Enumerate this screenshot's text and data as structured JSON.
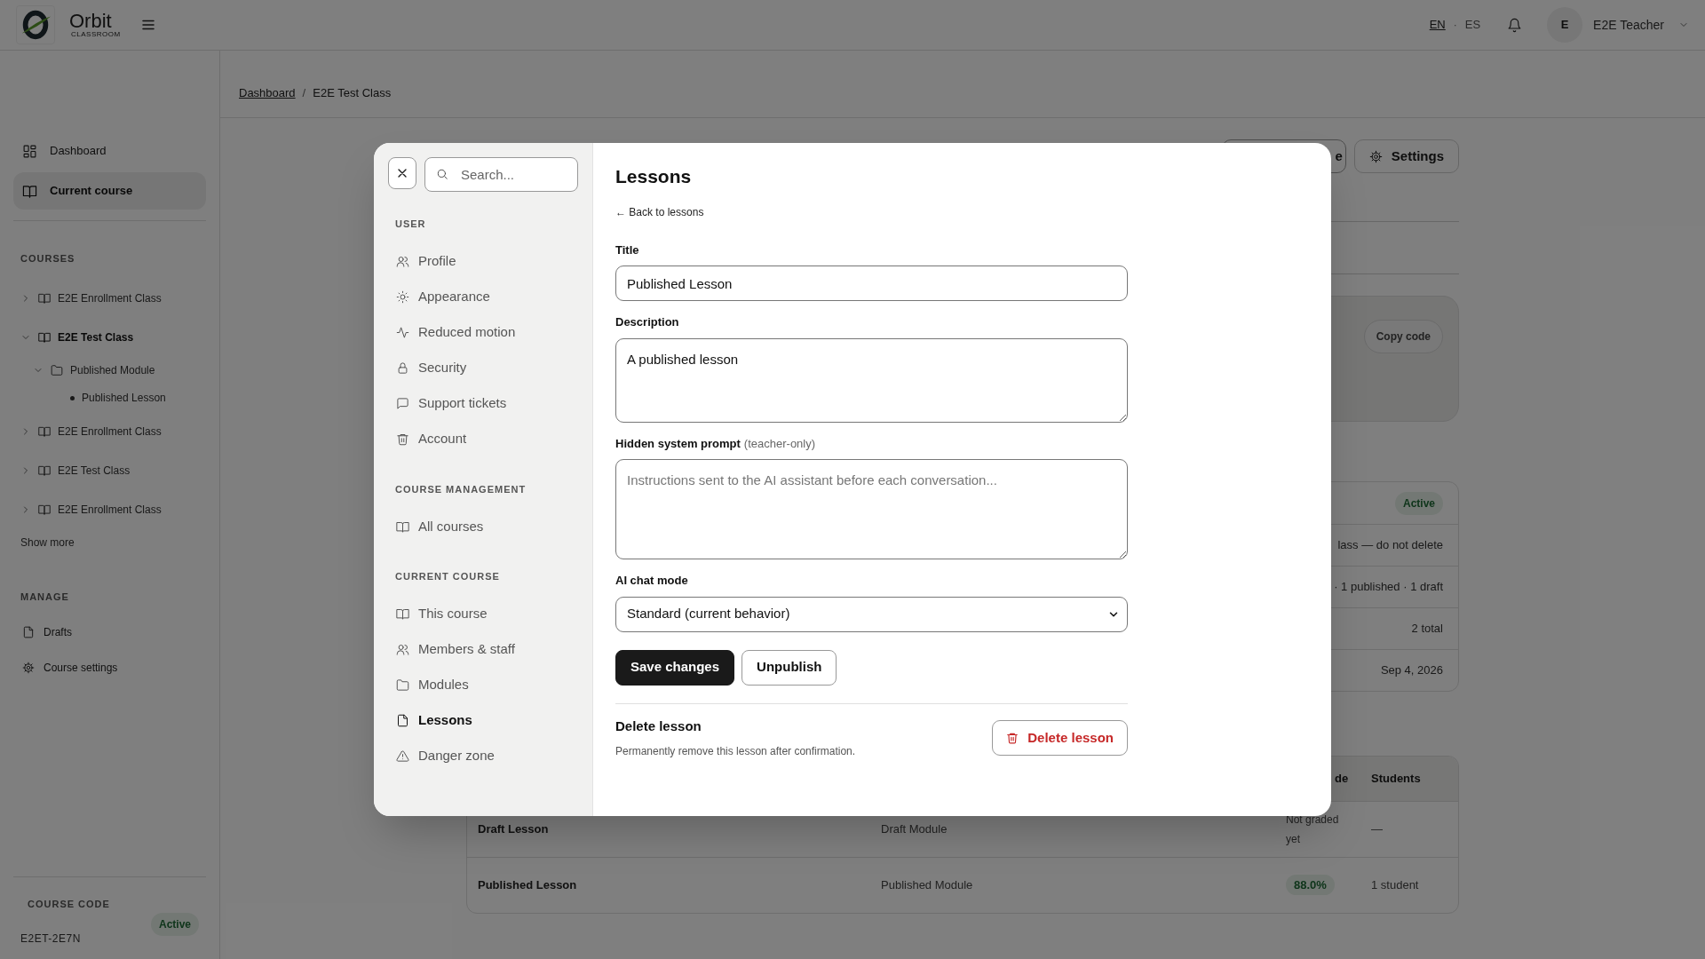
{
  "topbar": {
    "brand": "Orbit",
    "brand_sub": "CLASSROOM",
    "languages": [
      {
        "label": "EN",
        "selected": true
      },
      {
        "label": "ES",
        "selected": false
      }
    ],
    "language_separator": "·",
    "user": {
      "initial": "E",
      "name": "E2E Teacher"
    }
  },
  "sidebar": {
    "nav": [
      {
        "label": "Dashboard",
        "kind": "grid",
        "selected": false
      },
      {
        "label": "Current course",
        "kind": "book",
        "selected": true
      }
    ],
    "courses_heading": "COURSES",
    "courses": [
      {
        "kind": "course",
        "label": "E2E Enrollment Class",
        "selected": false,
        "expanded": false
      },
      {
        "kind": "course",
        "label": "E2E Test Class",
        "selected": true,
        "expanded": true,
        "children": [
          {
            "kind": "module",
            "label": "Published Module",
            "selected": false,
            "expanded": true,
            "children": [
              {
                "kind": "lesson",
                "label": "Published Lesson",
                "selected": false
              }
            ]
          }
        ]
      },
      {
        "kind": "course",
        "label": "E2E Enrollment Class",
        "selected": false,
        "expanded": false
      },
      {
        "kind": "course",
        "label": "E2E Test Class",
        "selected": false,
        "expanded": false
      },
      {
        "kind": "course",
        "label": "E2E Enrollment Class",
        "selected": false,
        "expanded": false
      }
    ],
    "show_more": "Show more",
    "manage_heading": "MANAGE",
    "manage": [
      {
        "label": "Drafts",
        "kind": "file"
      },
      {
        "label": "Course settings",
        "kind": "gear"
      }
    ],
    "course_code": {
      "heading": "COURSE CODE",
      "status": "Active",
      "code": "E2ET-2E7N"
    }
  },
  "breadcrumb": [
    {
      "label": "Dashboard",
      "kind": "link"
    },
    {
      "label": "/",
      "kind": "separator"
    },
    {
      "label": "E2E Test Class",
      "kind": "current"
    }
  ],
  "page": {
    "buttons": [
      {
        "label": "e",
        "kind": "plain"
      },
      {
        "label": "Settings",
        "kind": "gear"
      }
    ],
    "code_card": {
      "button": "Copy code"
    },
    "details": [
      {
        "kind": "badge",
        "text": "Active"
      },
      {
        "kind": "text",
        "text": "lass — do not delete"
      },
      {
        "kind": "text",
        "text": "· 1 published · 1 draft"
      },
      {
        "kind": "text",
        "text": "2 total"
      },
      {
        "kind": "text",
        "text": "Sep 4, 2026"
      }
    ],
    "table": {
      "columns": [
        "",
        "",
        "de",
        "Students"
      ],
      "rows": [
        {
          "cells": [
            "Draft Lesson",
            "Draft Module",
            "Not graded yet",
            "—"
          ],
          "kind": "ungraded"
        },
        {
          "cells": [
            "Published Lesson",
            "Published Module",
            "88.0%",
            "1 student"
          ],
          "kind": "graded"
        }
      ]
    }
  },
  "modal": {
    "search": {
      "placeholder": "Search..."
    },
    "sections": [
      {
        "heading": "USER",
        "items": [
          {
            "label": "Profile",
            "kind": "users",
            "selected": false
          },
          {
            "label": "Appearance",
            "kind": "sun",
            "selected": false
          },
          {
            "label": "Reduced motion",
            "kind": "activity",
            "selected": false
          },
          {
            "label": "Security",
            "kind": "lock",
            "selected": false
          },
          {
            "label": "Support tickets",
            "kind": "message",
            "selected": false
          },
          {
            "label": "Account",
            "kind": "trash",
            "selected": false
          }
        ]
      },
      {
        "heading": "COURSE MANAGEMENT",
        "items": [
          {
            "label": "All courses",
            "kind": "book",
            "selected": false
          }
        ]
      },
      {
        "heading": "CURRENT COURSE",
        "items": [
          {
            "label": "This course",
            "kind": "book",
            "selected": false
          },
          {
            "label": "Members & staff",
            "kind": "users",
            "selected": false
          },
          {
            "label": "Modules",
            "kind": "folder",
            "selected": false
          },
          {
            "label": "Lessons",
            "kind": "file",
            "selected": true
          },
          {
            "label": "Danger zone",
            "kind": "alert",
            "selected": false
          }
        ]
      }
    ],
    "form": {
      "title": "Lessons",
      "back_link": "← Back to lessons",
      "fields": [
        {
          "kind": "input",
          "label": "Title",
          "value": "Published Lesson"
        },
        {
          "kind": "textarea",
          "label": "Description",
          "value": "A published lesson"
        },
        {
          "kind": "textarea",
          "label": "Hidden system prompt",
          "hint": "(teacher-only)",
          "placeholder": "Instructions sent to the AI assistant before each conversation..."
        },
        {
          "kind": "select",
          "label": "AI chat mode",
          "value": "Standard (current behavior)"
        }
      ],
      "actions": [
        {
          "label": "Save changes",
          "kind": "primary"
        },
        {
          "label": "Unpublish",
          "kind": "secondary"
        }
      ],
      "danger": {
        "title": "Delete lesson",
        "description": "Permanently remove this lesson after confirmation.",
        "button": "Delete lesson"
      }
    }
  }
}
